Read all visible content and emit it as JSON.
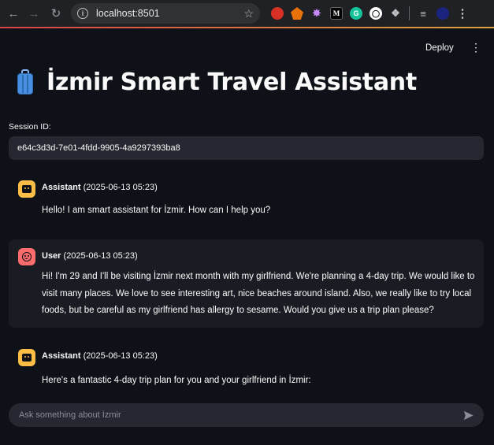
{
  "browser": {
    "url": "localhost:8501"
  },
  "app": {
    "deploy_label": "Deploy",
    "title": "İzmir Smart Travel Assistant",
    "session_label": "Session ID:",
    "session_id": "e64c3d3d-7e01-4fdd-9905-4a9297393ba8"
  },
  "messages": [
    {
      "role": "Assistant",
      "timestamp": "(2025-06-13 05:23)",
      "text": "Hello! I am smart assistant for İzmir. How can I help you?"
    },
    {
      "role": "User",
      "timestamp": "(2025-06-13 05:23)",
      "text": "Hi! I'm 29 and I'll be visiting İzmir next month with my girlfriend. We're planning a 4-day trip. We would like to visit many places. We love to see interesting art, nice beaches around island. Also, we really like to try local foods, but be careful as my girlfriend has allergy to sesame. Would you give us a trip plan please?"
    },
    {
      "role": "Assistant",
      "timestamp": "(2025-06-13 05:23)",
      "text": "Here's a fantastic 4-day trip plan for you and your girlfriend in İzmir:"
    }
  ],
  "chat_input": {
    "placeholder": "Ask something about İzmir"
  },
  "colors": {
    "background": "#0e1117",
    "assistant_avatar": "#ffbd45",
    "user_avatar": "#ff6c6c",
    "input_bg": "#262730"
  }
}
